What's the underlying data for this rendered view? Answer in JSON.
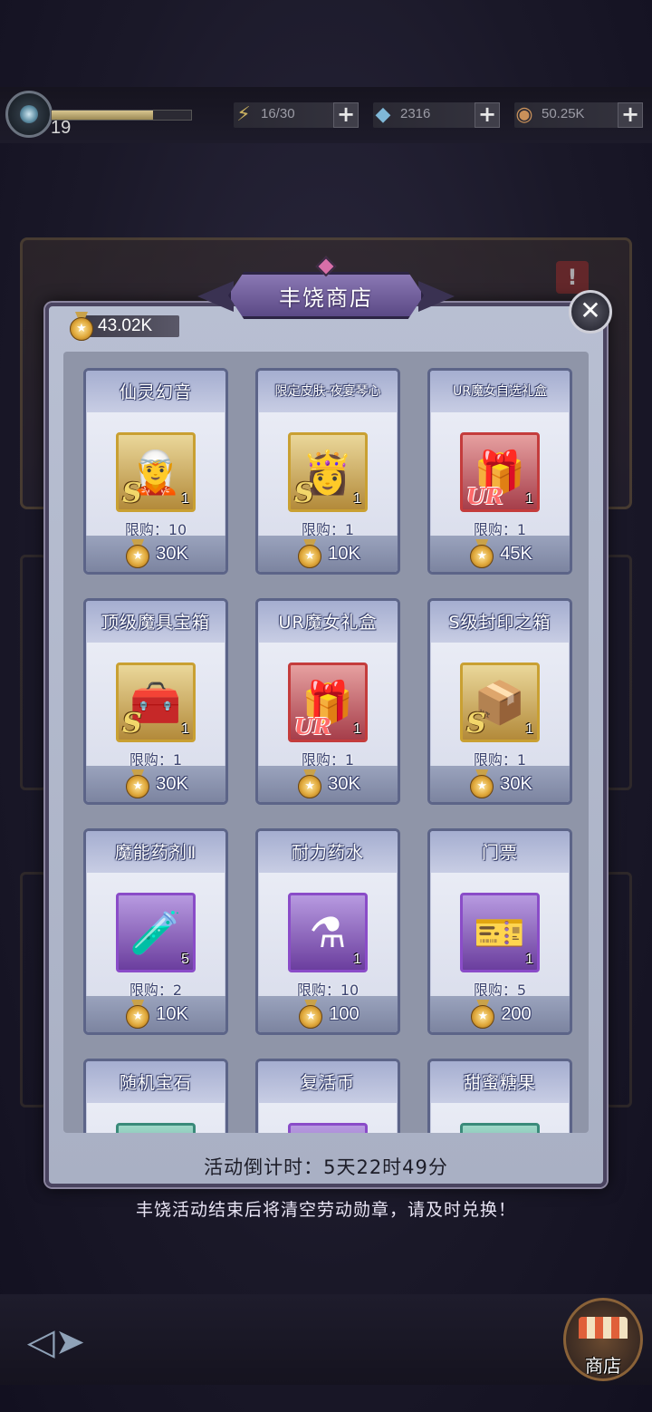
{
  "status": {
    "level": "19",
    "xp_progress": 0.73,
    "energy": "16/30",
    "gems": "2316",
    "gold": "50.25K"
  },
  "modal": {
    "title": "丰饶商店",
    "balance": "43.02K",
    "countdown": "活动倒计时：5天22时49分",
    "notice": "丰饶活动结束后将清空劳动勋章，请及时兑换！"
  },
  "items": [
    {
      "name": "仙灵幻音",
      "limit": "限购：10",
      "price": "30K",
      "qty": "1",
      "grade": "S",
      "icon": "elf-portrait-icon",
      "frame": "gold",
      "glyph": "🧝"
    },
    {
      "name": "限定皮肤-夜宴琴心",
      "limit": "限购：1",
      "price": "10K",
      "qty": "1",
      "grade": "S",
      "icon": "skin-portrait-icon",
      "frame": "gold",
      "glyph": "👸"
    },
    {
      "name": "UR魔女自选礼盒",
      "limit": "限购：1",
      "price": "45K",
      "qty": "1",
      "grade": "UR",
      "icon": "gift-box-icon",
      "frame": "red",
      "glyph": "🎁"
    },
    {
      "name": "顶级魔具宝箱",
      "limit": "限购：1",
      "price": "30K",
      "qty": "1",
      "grade": "S",
      "icon": "treasure-chest-icon",
      "frame": "gold",
      "glyph": "🧰"
    },
    {
      "name": "UR魔女礼盒",
      "limit": "限购：1",
      "price": "30K",
      "qty": "1",
      "grade": "UR",
      "icon": "gift-box-icon",
      "frame": "red",
      "glyph": "🎁"
    },
    {
      "name": "S级封印之箱",
      "limit": "限购：1",
      "price": "30K",
      "qty": "1",
      "grade": "S",
      "icon": "sealed-box-icon",
      "frame": "gold",
      "glyph": "📦"
    },
    {
      "name": "魔能药剂Ⅱ",
      "limit": "限购：2",
      "price": "10K",
      "qty": "5",
      "grade": "",
      "icon": "red-potion-icon",
      "frame": "purple",
      "glyph": "🧪"
    },
    {
      "name": "耐力药水",
      "limit": "限购：10",
      "price": "100",
      "qty": "1",
      "grade": "",
      "icon": "blue-potion-icon",
      "frame": "purple",
      "glyph": "⚗"
    },
    {
      "name": "门票",
      "limit": "限购：5",
      "price": "200",
      "qty": "1",
      "grade": "",
      "icon": "ticket-icon",
      "frame": "purple",
      "glyph": "🎫"
    },
    {
      "name": "随机宝石",
      "limit": "",
      "price": "",
      "qty": "",
      "grade": "",
      "icon": "gem-icon",
      "frame": "teal",
      "glyph": ""
    },
    {
      "name": "复活币",
      "limit": "",
      "price": "",
      "qty": "",
      "grade": "",
      "icon": "revive-coin-icon",
      "frame": "purple",
      "glyph": ""
    },
    {
      "name": "甜蜜糖果",
      "limit": "",
      "price": "",
      "qty": "",
      "grade": "",
      "icon": "candy-icon",
      "frame": "teal",
      "glyph": ""
    }
  ],
  "bottom": {
    "shop_label": "商店"
  }
}
